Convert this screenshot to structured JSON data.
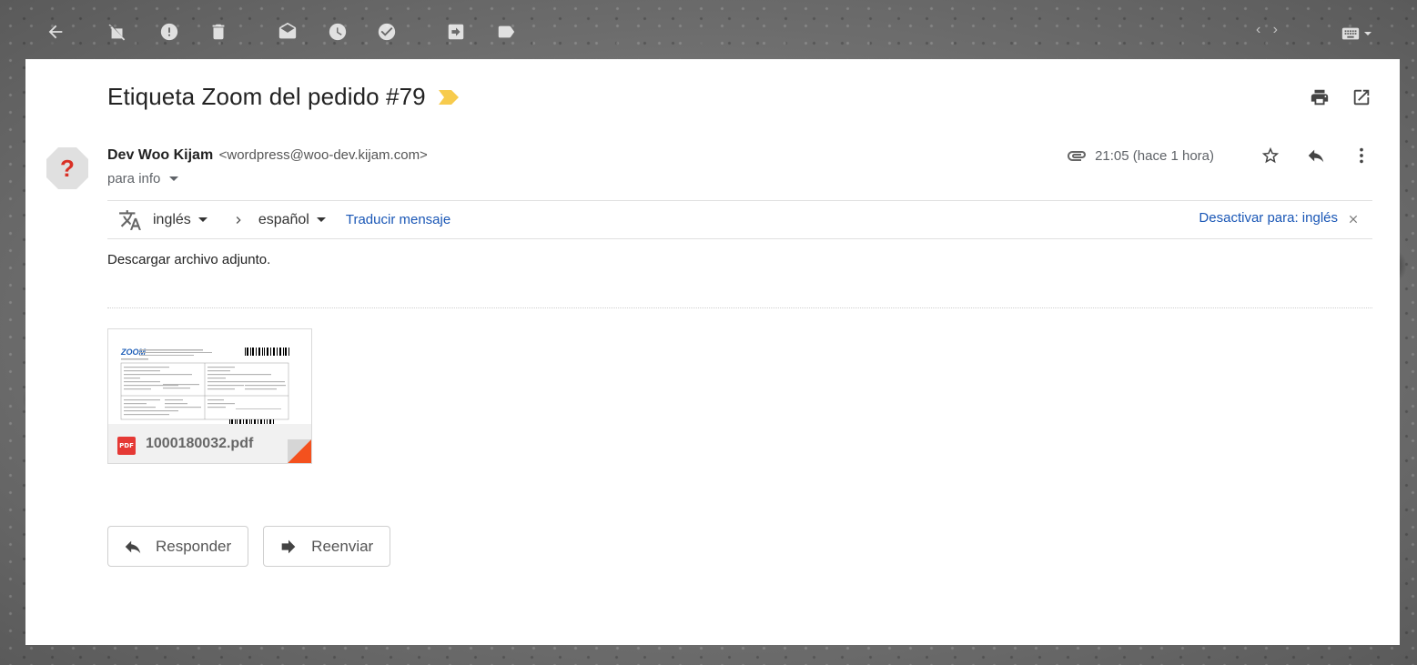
{
  "toolbar": {
    "icons": [
      "back-arrow-icon",
      "mark-not-spam-icon",
      "report-icon",
      "trash-icon",
      "mark-unread-icon",
      "snooze-icon",
      "add-task-icon",
      "move-to-icon",
      "label-icon",
      "keyboard-icon"
    ]
  },
  "message": {
    "subject": "Etiqueta Zoom del pedido #79",
    "importance_color": "#f7cb4d",
    "sender_name": "Dev Woo Kijam",
    "sender_email": "<wordpress@woo-dev.kijam.com>",
    "recipient": "para info",
    "time": "21:05 (hace 1 hora)",
    "body": "Descargar archivo adjunto."
  },
  "translate": {
    "from_lang": "inglés",
    "to_lang": "español",
    "translate_link": "Traducir mensaje",
    "disable_link": "Desactivar para: inglés"
  },
  "attachment": {
    "badge": "PDF",
    "filename": "1000180032.pdf",
    "preview_brand": "ZOOM"
  },
  "actions": {
    "reply": "Responder",
    "forward": "Reenviar"
  },
  "colors": {
    "link": "#1a57b6",
    "pdf_red": "#e53935",
    "avatar_question": "#d93025"
  }
}
